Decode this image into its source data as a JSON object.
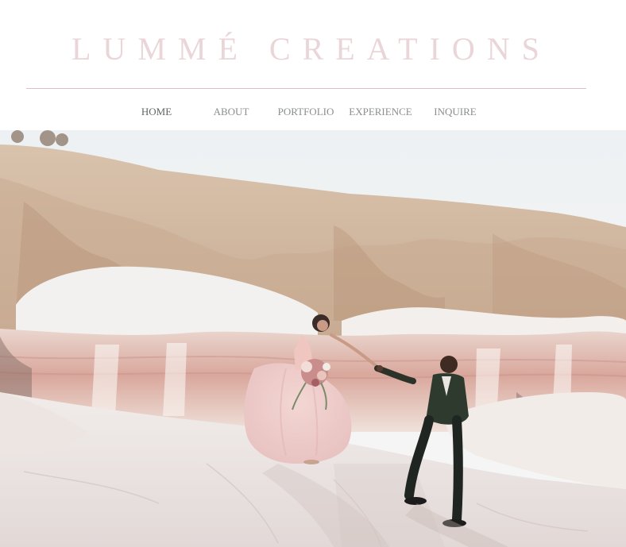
{
  "brand": {
    "title": "LUMMÉ CREATIONS"
  },
  "nav": {
    "items": [
      {
        "label": "HOME",
        "active": true
      },
      {
        "label": "ABOUT",
        "active": false
      },
      {
        "label": "PORTFOLIO",
        "active": false
      },
      {
        "label": "EXPERIENCE",
        "active": false
      },
      {
        "label": "INQUIRE",
        "active": false
      }
    ]
  },
  "colors": {
    "brand_pink": "#ead6d8",
    "divider": "#dcbfc8",
    "nav_text": "#8a8f8d",
    "nav_active": "#5e6763"
  }
}
